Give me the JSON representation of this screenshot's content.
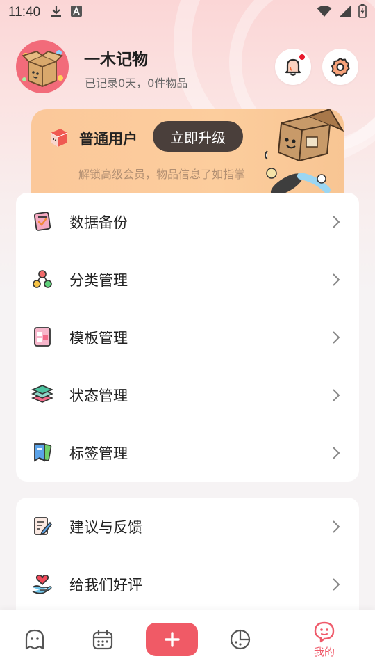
{
  "status_bar": {
    "time": "11:40",
    "icons": [
      "download-icon",
      "keyboard-a-icon",
      "wifi-icon",
      "signal-icon",
      "battery-charging-icon"
    ]
  },
  "profile": {
    "app_name": "一木记物",
    "subtitle": "已记录0天，0件物品",
    "has_notification": true
  },
  "vip": {
    "title": "普通用户",
    "upgrade_button": "立即升级",
    "description": "解锁高级会员，物品信息了如指掌"
  },
  "menu_group_1": [
    {
      "label": "数据备份",
      "icon": "backup-icon"
    },
    {
      "label": "分类管理",
      "icon": "category-tree-icon"
    },
    {
      "label": "模板管理",
      "icon": "template-icon"
    },
    {
      "label": "状态管理",
      "icon": "layers-icon"
    },
    {
      "label": "标签管理",
      "icon": "tag-icon"
    }
  ],
  "menu_group_2": [
    {
      "label": "建议与反馈",
      "icon": "feedback-icon"
    },
    {
      "label": "给我们好评",
      "icon": "heart-hand-icon"
    }
  ],
  "bottom_nav": {
    "items": [
      "home-icon",
      "calendar-icon",
      "add-icon",
      "stats-icon",
      "mine-icon"
    ],
    "active_label": "我的"
  },
  "colors": {
    "accent": "#f05a66",
    "vip_button": "#4a3f3b",
    "vip_bg": "#fccd9d"
  }
}
